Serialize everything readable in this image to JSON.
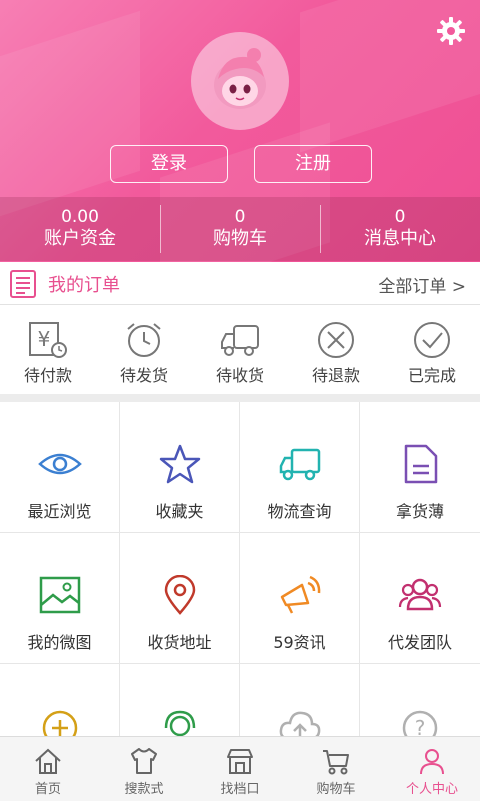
{
  "header": {
    "login_label": "登录",
    "register_label": "注册",
    "stats": [
      {
        "value": "0.00",
        "label": "账户资金"
      },
      {
        "value": "0",
        "label": "购物车"
      },
      {
        "value": "0",
        "label": "消息中心"
      }
    ]
  },
  "orders": {
    "title": "我的订单",
    "all_label": "全部订单 >",
    "items": [
      {
        "label": "待付款",
        "icon": "payment-pending-icon"
      },
      {
        "label": "待发货",
        "icon": "alarm-clock-icon"
      },
      {
        "label": "待收货",
        "icon": "truck-icon"
      },
      {
        "label": "待退款",
        "icon": "circle-x-icon"
      },
      {
        "label": "已完成",
        "icon": "circle-check-icon"
      }
    ]
  },
  "grid": [
    {
      "label": "最近浏览",
      "icon": "eye-icon",
      "color": "#3b7fd1"
    },
    {
      "label": "收藏夹",
      "icon": "star-icon",
      "color": "#4a56b8"
    },
    {
      "label": "物流查询",
      "icon": "truck-icon",
      "color": "#22b3b0"
    },
    {
      "label": "拿货薄",
      "icon": "document-icon",
      "color": "#7a4fb3"
    },
    {
      "label": "我的微图",
      "icon": "image-icon",
      "color": "#2f9c4a"
    },
    {
      "label": "收货地址",
      "icon": "location-pin-icon",
      "color": "#c0392b"
    },
    {
      "label": "59资讯",
      "icon": "megaphone-icon",
      "color": "#f08a24"
    },
    {
      "label": "代发团队",
      "icon": "team-icon",
      "color": "#c2306f"
    },
    {
      "label": "",
      "icon": "add-circle-icon",
      "color": "#d4a017"
    },
    {
      "label": "",
      "icon": "headset-icon",
      "color": "#2f9c4a"
    },
    {
      "label": "",
      "icon": "cloud-upload-icon",
      "color": "#999999"
    },
    {
      "label": "",
      "icon": "help-icon",
      "color": "#999999"
    }
  ],
  "tabs": [
    {
      "label": "首页",
      "icon": "home-icon"
    },
    {
      "label": "搜款式",
      "icon": "shirt-icon"
    },
    {
      "label": "找档口",
      "icon": "shop-icon"
    },
    {
      "label": "购物车",
      "icon": "cart-icon"
    },
    {
      "label": "个人中心",
      "icon": "person-icon",
      "active": true
    }
  ],
  "colors": {
    "brand": "#ee4f93",
    "accent_text": "#e8508f"
  }
}
